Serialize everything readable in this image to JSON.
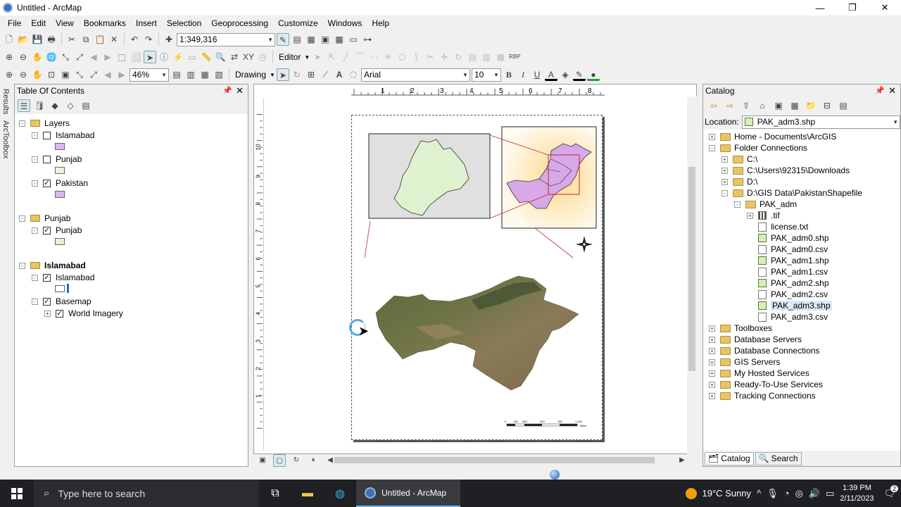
{
  "window": {
    "title": "Untitled - ArcMap"
  },
  "menu": [
    "File",
    "Edit",
    "View",
    "Bookmarks",
    "Insert",
    "Selection",
    "Geoprocessing",
    "Customize",
    "Windows",
    "Help"
  ],
  "toolbar": {
    "scale": "1:349,316",
    "editor_label": "Editor",
    "zoom": "46%",
    "drawing_label": "Drawing",
    "font_name": "Arial",
    "font_size": "10",
    "bold": "B",
    "italic": "I",
    "underline": "U",
    "font_color": "A"
  },
  "side_tabs": [
    "Results",
    "ArcToolbox"
  ],
  "toc": {
    "title": "Table Of Contents",
    "items": [
      {
        "label": "Layers",
        "level": 0,
        "group": true
      },
      {
        "label": "Islamabad",
        "level": 1,
        "checked": false,
        "swatch": "#d8b8ee"
      },
      {
        "label": "Punjab",
        "level": 1,
        "checked": false,
        "swatch": "#eef2dc"
      },
      {
        "label": "Pakistan",
        "level": 1,
        "checked": true,
        "swatch": "#d8b8ee"
      },
      {
        "label": "Punjab",
        "level": 0,
        "group": true
      },
      {
        "label": "Punjab",
        "level": 1,
        "checked": true,
        "swatch": "#e6f2d2"
      },
      {
        "label": "Islamabad",
        "level": 0,
        "group": true,
        "bold": true
      },
      {
        "label": "Islamabad",
        "level": 1,
        "checked": true,
        "swatch": "#ffffff"
      },
      {
        "label": "Basemap",
        "level": 1,
        "checked": true
      },
      {
        "label": "World Imagery",
        "level": 2,
        "checked": true
      }
    ]
  },
  "ruler": {
    "h": [
      "1",
      "2",
      "3",
      "4",
      "5",
      "6",
      "7",
      "8"
    ],
    "v": [
      "10",
      "9",
      "8",
      "7",
      "6",
      "5",
      "4",
      "3",
      "2",
      "1"
    ]
  },
  "scalebar": {
    "ticks": [
      "0",
      "130",
      "260",
      "520",
      "780",
      "1,040"
    ],
    "unit": "Miles"
  },
  "catalog": {
    "title": "Catalog",
    "location_label": "Location:",
    "location_value": "PAK_adm3.shp",
    "tree": [
      {
        "label": "Home - Documents\\ArcGIS",
        "level": 0,
        "type": "home",
        "toggle": "+"
      },
      {
        "label": "Folder Connections",
        "level": 0,
        "type": "folder",
        "toggle": "-"
      },
      {
        "label": "C:\\",
        "level": 1,
        "type": "folder",
        "toggle": "+"
      },
      {
        "label": "C:\\Users\\92315\\Downloads",
        "level": 1,
        "type": "folder",
        "toggle": "+"
      },
      {
        "label": "D:\\",
        "level": 1,
        "type": "folder",
        "toggle": "+"
      },
      {
        "label": "D:\\GIS Data\\PakistanShapefile",
        "level": 1,
        "type": "folder",
        "toggle": "-"
      },
      {
        "label": "PAK_adm",
        "level": 2,
        "type": "folder",
        "toggle": "-"
      },
      {
        "label": ".tif",
        "level": 3,
        "type": "raster",
        "toggle": "+"
      },
      {
        "label": "license.txt",
        "level": 3,
        "type": "file"
      },
      {
        "label": "PAK_adm0.shp",
        "level": 3,
        "type": "shp"
      },
      {
        "label": "PAK_adm0.csv",
        "level": 3,
        "type": "file"
      },
      {
        "label": "PAK_adm1.shp",
        "level": 3,
        "type": "shp"
      },
      {
        "label": "PAK_adm1.csv",
        "level": 3,
        "type": "file"
      },
      {
        "label": "PAK_adm2.shp",
        "level": 3,
        "type": "shp"
      },
      {
        "label": "PAK_adm2.csv",
        "level": 3,
        "type": "file"
      },
      {
        "label": "PAK_adm3.shp",
        "level": 3,
        "type": "shp",
        "selected": true
      },
      {
        "label": "PAK_adm3.csv",
        "level": 3,
        "type": "file"
      },
      {
        "label": "Toolboxes",
        "level": 0,
        "type": "folder",
        "toggle": "+"
      },
      {
        "label": "Database Servers",
        "level": 0,
        "type": "folder",
        "toggle": "+"
      },
      {
        "label": "Database Connections",
        "level": 0,
        "type": "folder",
        "toggle": "+"
      },
      {
        "label": "GIS Servers",
        "level": 0,
        "type": "folder",
        "toggle": "+"
      },
      {
        "label": "My Hosted Services",
        "level": 0,
        "type": "folder",
        "toggle": "+"
      },
      {
        "label": "Ready-To-Use Services",
        "level": 0,
        "type": "folder",
        "toggle": "+"
      },
      {
        "label": "Tracking Connections",
        "level": 0,
        "type": "folder",
        "toggle": "+"
      }
    ],
    "tabs": [
      "Catalog",
      "Search"
    ]
  },
  "taskbar": {
    "search_placeholder": "Type here to search",
    "active_app": "Untitled - ArcMap",
    "weather": "19°C  Sunny",
    "time": "1:39 PM",
    "date": "2/11/2023",
    "notif_count": "2"
  }
}
